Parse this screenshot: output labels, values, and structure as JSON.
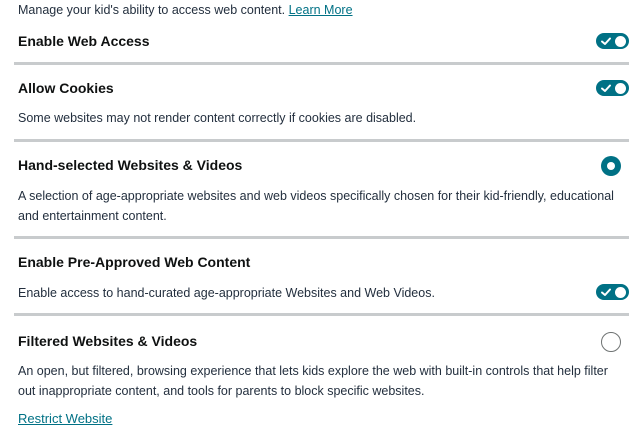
{
  "intro": {
    "text": "Manage your kid's ability to access web content.",
    "learn_more": "Learn More"
  },
  "web_access": {
    "title": "Enable Web Access",
    "enabled": true
  },
  "cookies": {
    "title": "Allow Cookies",
    "description": "Some websites may not render content correctly if cookies are disabled.",
    "enabled": true
  },
  "hand_selected": {
    "title": "Hand-selected Websites & Videos",
    "description": "A selection of age-appropriate websites and web videos specifically chosen for their kid-friendly, educational and entertainment content.",
    "selected": true
  },
  "pre_approved": {
    "title": "Enable Pre-Approved Web Content",
    "description": "Enable access to hand-curated age-appropriate Websites and Web Videos.",
    "enabled": true
  },
  "filtered": {
    "title": "Filtered Websites & Videos",
    "description": "An open, but filtered, browsing experience that lets kids explore the web with built-in controls that help filter out inappropriate content, and tools for parents to block specific websites.",
    "selected": false
  },
  "restrict_website": {
    "label": "Restrict Website"
  },
  "colors": {
    "accent": "#007185",
    "divider": "#c8cbcd",
    "text": "#0f1111",
    "toggle_knob": "#ffffff"
  },
  "icons": {
    "toggle_check": "check-icon"
  }
}
